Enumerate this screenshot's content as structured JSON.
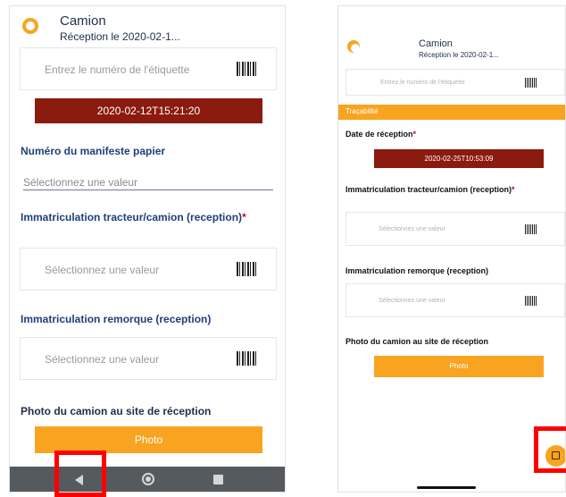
{
  "left": {
    "header": {
      "title": "Camion",
      "subtitle": "Réception le 2020-02-1..."
    },
    "label_field": {
      "placeholder": "Entrez le numéro de l'étiquette",
      "icon": "barcode-icon"
    },
    "date_value": "2020-02-12T15:21:20",
    "manifest": {
      "label": "Numéro du manifeste papier",
      "placeholder": "Sélectionnez une valeur"
    },
    "tractor": {
      "label": "Immatriculation tracteur/camion (reception)",
      "required": "*",
      "placeholder": "Sélectionnez une valeur"
    },
    "trailer": {
      "label": "Immatriculation remorque (reception)",
      "placeholder": "Sélectionnez une valeur"
    },
    "photo": {
      "label": "Photo du camion au site de réception",
      "button": "Photo"
    },
    "navbar": {
      "back": "back-icon",
      "home": "home-icon",
      "recents": "recents-icon"
    }
  },
  "right": {
    "header": {
      "title": "Camion",
      "subtitle": "Réception le 2020-02-1..."
    },
    "label_field": {
      "placeholder": "Entrez le numéro de l'étiquette"
    },
    "section": "Traçabilité",
    "date": {
      "label": "Date de réception",
      "required": "*",
      "value": "2020-02-25T10:53:09"
    },
    "tractor": {
      "label": "Immatriculation tracteur/camion (reception)",
      "required": "*",
      "placeholder": "Sélectionnez une valeur"
    },
    "trailer": {
      "label": "Immatriculation remorque (reception)",
      "placeholder": "Sélectionnez une valeur"
    },
    "photo": {
      "label": "Photo du camion au site de réception",
      "button": "Photo"
    },
    "fab": "save-icon"
  },
  "colors": {
    "accent": "#f8a421",
    "date_bar": "#8b1a0f",
    "label_blue": "#1f3f7a",
    "highlight": "#ff0000"
  }
}
